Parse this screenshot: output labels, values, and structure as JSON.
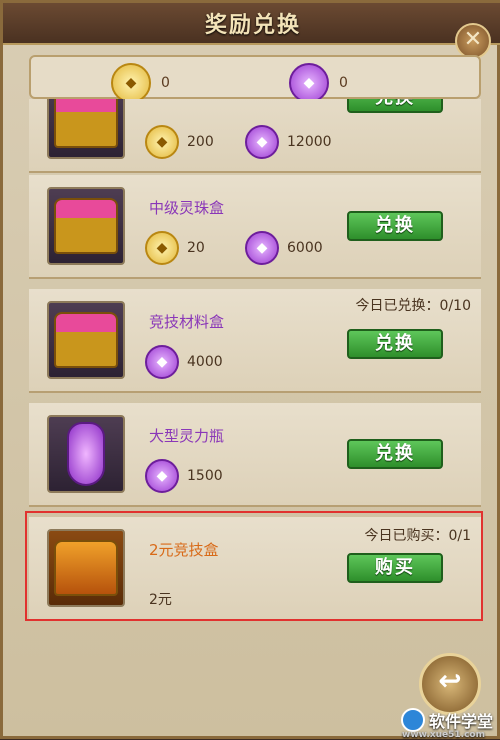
{
  "title": "奖励兑换",
  "close_icon": "close-icon",
  "currency": {
    "gold": {
      "icon": "gold-gem-icon",
      "value": "0"
    },
    "purple": {
      "icon": "purple-gem-icon",
      "value": "0"
    }
  },
  "items": [
    {
      "name": "",
      "gold_cost": "200",
      "purple_cost": "12000",
      "limit": "",
      "button": "兑换",
      "icon": "gift-chest-icon"
    },
    {
      "name": "中级灵珠盒",
      "gold_cost": "20",
      "purple_cost": "6000",
      "limit": "",
      "button": "兑换",
      "icon": "gift-chest-icon"
    },
    {
      "name": "竞技材料盒",
      "gold_cost": "",
      "purple_cost": "4000",
      "limit": "今日已兑换：0/10",
      "button": "兑换",
      "icon": "gift-chest-icon"
    },
    {
      "name": "大型灵力瓶",
      "gold_cost": "",
      "purple_cost": "1500",
      "limit": "",
      "button": "兑换",
      "icon": "potion-bottle-icon"
    },
    {
      "name": "2元竞技盒",
      "price": "2元",
      "limit": "今日已购买：0/1",
      "button": "购买",
      "icon": "treasure-chest-icon"
    }
  ],
  "back_button_icon": "back-arrow-icon",
  "watermark": {
    "text": "软件学堂",
    "sub": "www.xue51.com"
  }
}
